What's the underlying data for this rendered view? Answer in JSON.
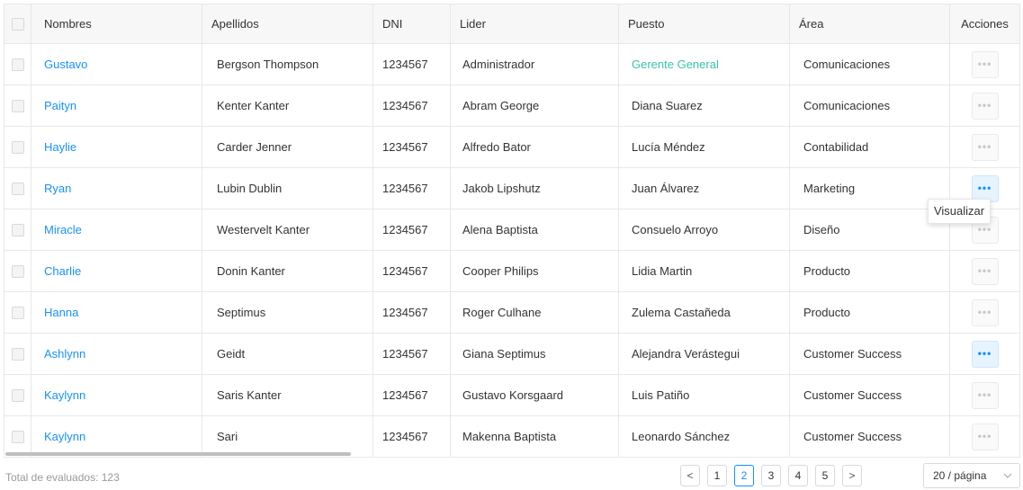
{
  "table": {
    "headers": {
      "nombres": "Nombres",
      "apellidos": "Apellidos",
      "dni": "DNI",
      "lider": "Lider",
      "puesto": "Puesto",
      "area": "Área",
      "acciones": "Acciones"
    },
    "rows": [
      {
        "nombres": "Gustavo",
        "apellidos": "Bergson Thompson",
        "dni": "1234567",
        "lider": "Administrador",
        "puesto": "Gerente General",
        "area": "Comunicaciones"
      },
      {
        "nombres": "Paityn",
        "apellidos": "Kenter Kanter",
        "dni": "1234567",
        "lider": "Abram George",
        "puesto": "Diana Suarez",
        "area": "Comunicaciones"
      },
      {
        "nombres": "Haylie",
        "apellidos": "Carder Jenner",
        "dni": "1234567",
        "lider": "Alfredo Bator",
        "puesto": "Lucía Méndez",
        "area": "Contabilidad"
      },
      {
        "nombres": "Ryan",
        "apellidos": "Lubin Dublin",
        "dni": "1234567",
        "lider": "Jakob Lipshutz",
        "puesto": "Juan Álvarez",
        "area": "Marketing"
      },
      {
        "nombres": "Miracle",
        "apellidos": "Westervelt Kanter",
        "dni": "1234567",
        "lider": "Alena Baptista",
        "puesto": "Consuelo Arroyo",
        "area": "Diseño"
      },
      {
        "nombres": "Charlie",
        "apellidos": "Donin Kanter",
        "dni": "1234567",
        "lider": "Cooper Philips",
        "puesto": "Lidia Martin",
        "area": "Producto"
      },
      {
        "nombres": "Hanna",
        "apellidos": "Septimus",
        "dni": "1234567",
        "lider": "Roger Culhane",
        "puesto": "Zulema Castañeda",
        "area": "Producto"
      },
      {
        "nombres": "Ashlynn",
        "apellidos": "Geidt",
        "dni": "1234567",
        "lider": "Giana Septimus",
        "puesto": "Alejandra Verástegui",
        "area": "Customer Success"
      },
      {
        "nombres": "Kaylynn",
        "apellidos": "Saris Kanter",
        "dni": "1234567",
        "lider": "Gustavo Korsgaard",
        "puesto": "Luis Patiño",
        "area": "Customer Success"
      },
      {
        "nombres": "Kaylynn",
        "apellidos": "Sari",
        "dni": "1234567",
        "lider": "Makenna Baptista",
        "puesto": "Leonardo Sánchez",
        "area": "Customer Success"
      }
    ],
    "action_label": "•••"
  },
  "tooltip": {
    "text": "Visualizar"
  },
  "footer": {
    "total": "Total de evaluados: 123",
    "prev": "<",
    "next": ">",
    "pages": [
      "1",
      "2",
      "3",
      "4",
      "5"
    ],
    "current_page": "2",
    "page_size": "20 / página"
  },
  "colors": {
    "link": "#1890ff",
    "puesto_highlight": "#3cc3a9",
    "header_bg": "#f7f7f7"
  }
}
